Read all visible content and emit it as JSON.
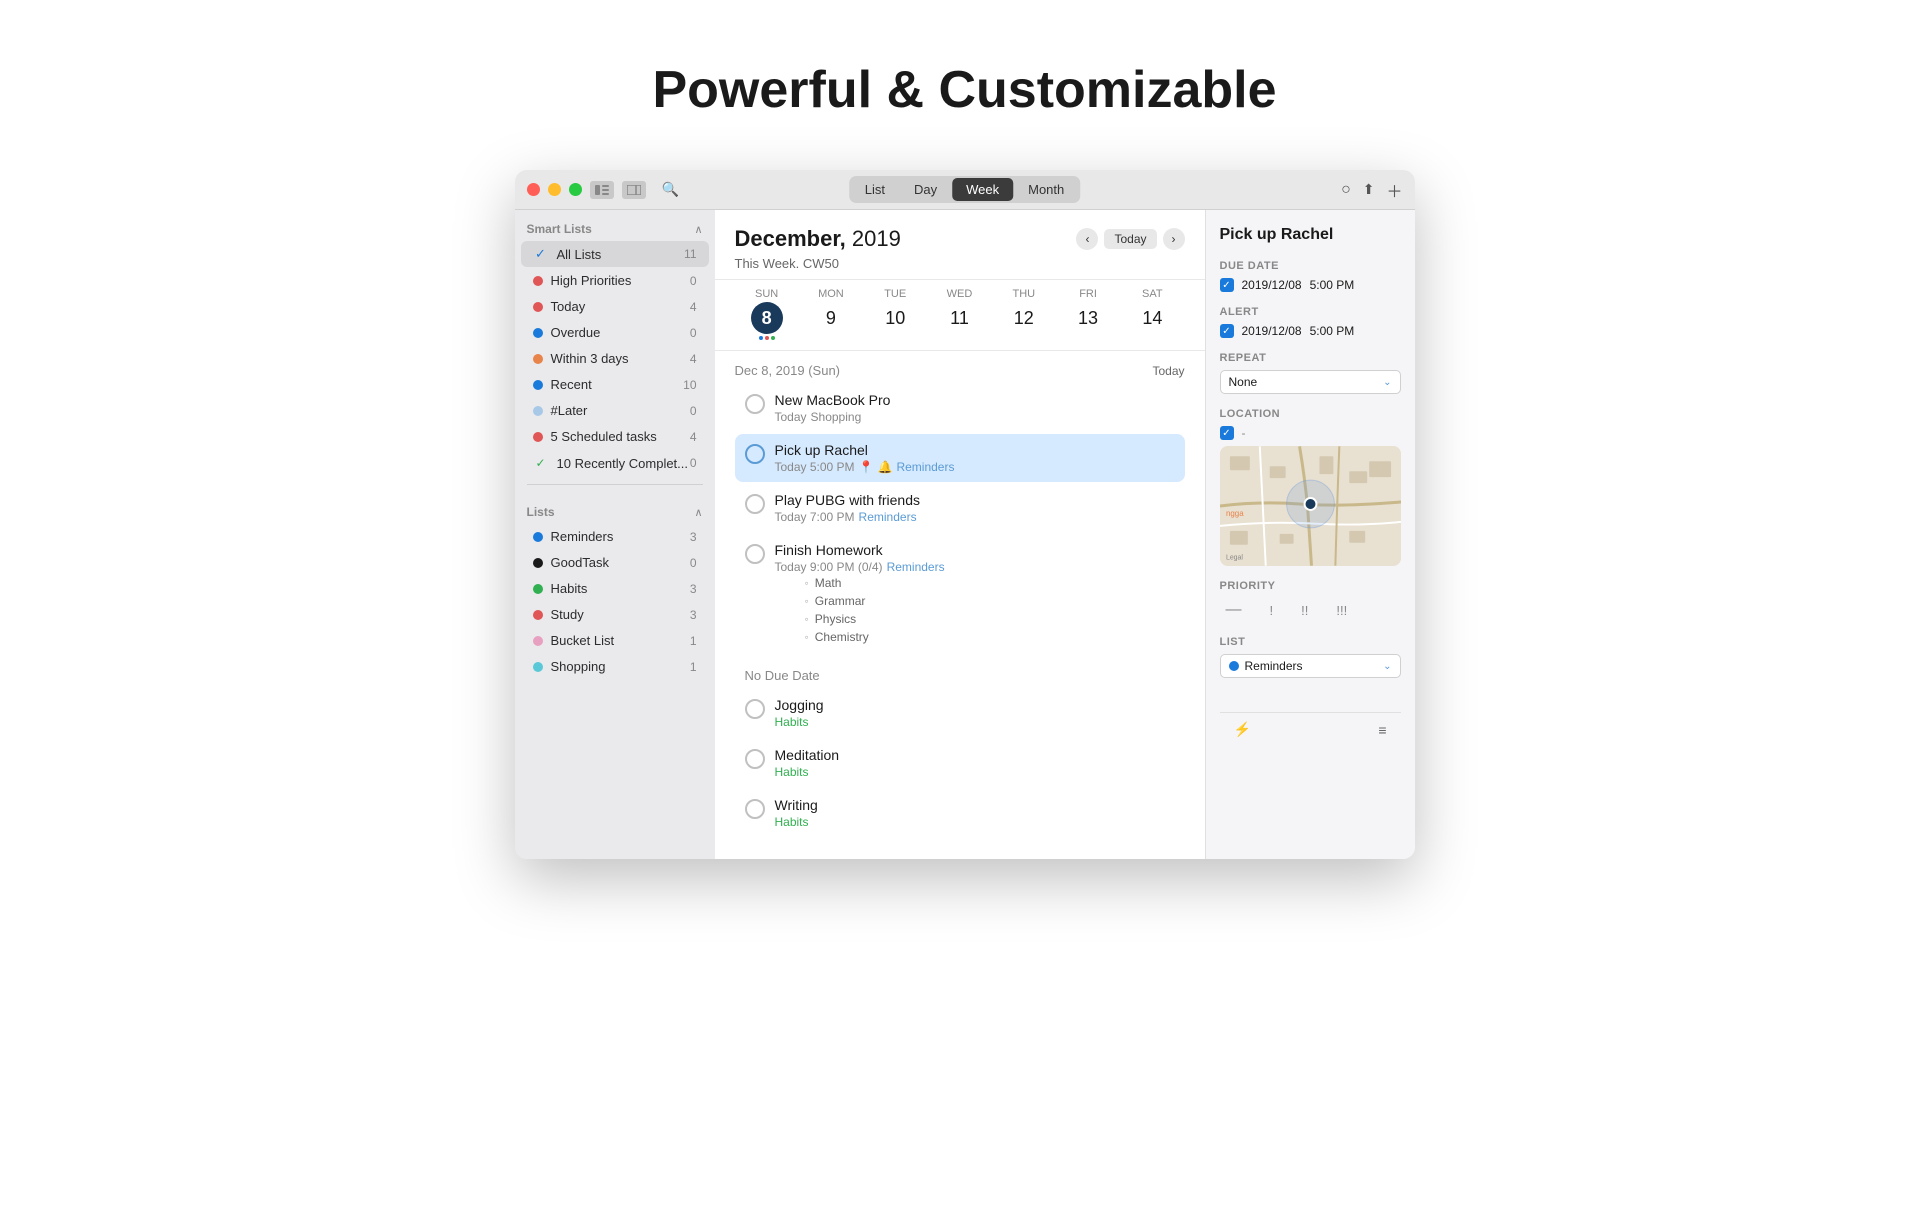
{
  "page": {
    "headline": "Powerful & Customizable"
  },
  "titlebar": {
    "segments": [
      "List",
      "Day",
      "Week",
      "Month"
    ],
    "active_segment": "Week",
    "right_icons": [
      "○",
      "⬆",
      "+"
    ]
  },
  "sidebar": {
    "smart_lists_label": "Smart Lists",
    "lists_label": "Lists",
    "smart_items": [
      {
        "id": "all-lists",
        "label": "All Lists",
        "count": "11",
        "color": "#1a7adb",
        "icon": "✓",
        "active": true
      },
      {
        "id": "high-priorities",
        "label": "High Priorities",
        "count": "0",
        "color": "#e05555",
        "dot": true
      },
      {
        "id": "today",
        "label": "Today",
        "count": "4",
        "color": "#e05555",
        "dot": true
      },
      {
        "id": "overdue",
        "label": "Overdue",
        "count": "0",
        "color": "#1a7adb",
        "dot": true
      },
      {
        "id": "within-3-days",
        "label": "Within 3 days",
        "count": "4",
        "color": "#e8834a",
        "dot": true
      },
      {
        "id": "recent",
        "label": "Recent",
        "count": "10",
        "color": "#1a7adb",
        "dot": true
      },
      {
        "id": "later",
        "label": "#Later",
        "count": "0",
        "color": "#a8c8e8",
        "dot": true
      },
      {
        "id": "scheduled",
        "label": "5 Scheduled tasks",
        "count": "4",
        "color": "#e05555",
        "dot": true
      },
      {
        "id": "recently-completed",
        "label": "10 Recently Complet...",
        "count": "0",
        "color": "#30b050",
        "icon": "✓",
        "dot": false
      }
    ],
    "list_items": [
      {
        "id": "reminders",
        "label": "Reminders",
        "count": "3",
        "color": "#1a7adb",
        "dot": true
      },
      {
        "id": "goodtask",
        "label": "GoodTask",
        "count": "0",
        "color": "#1a1a1a",
        "dot": true
      },
      {
        "id": "habits",
        "label": "Habits",
        "count": "3",
        "color": "#30b050",
        "dot": true
      },
      {
        "id": "study",
        "label": "Study",
        "count": "3",
        "color": "#e05555",
        "dot": true
      },
      {
        "id": "bucket-list",
        "label": "Bucket List",
        "count": "1",
        "color": "#e8a0c0",
        "dot": true
      },
      {
        "id": "shopping",
        "label": "Shopping",
        "count": "1",
        "color": "#5bc8d8",
        "dot": true
      }
    ]
  },
  "calendar": {
    "title_bold": "December,",
    "title_year": " 2019",
    "subtitle": "This Week. CW50",
    "today_btn": "Today",
    "date_label": "Dec 8, 2019 (Sun)",
    "today_label": "Today",
    "week_days": [
      {
        "name": "Sun",
        "num": "8",
        "today": true
      },
      {
        "name": "Mon",
        "num": "9",
        "today": false
      },
      {
        "name": "Tue",
        "num": "10",
        "today": false
      },
      {
        "name": "Wed",
        "num": "11",
        "today": false
      },
      {
        "name": "Thu",
        "num": "12",
        "today": false
      },
      {
        "name": "Fri",
        "num": "13",
        "today": false
      },
      {
        "name": "Sat",
        "num": "14",
        "today": false
      }
    ]
  },
  "tasks": {
    "today_section": "Dec 8, 2019 (Sun)",
    "today_label": "Today",
    "items": [
      {
        "id": "new-macbook",
        "title": "New MacBook Pro",
        "meta": "Today  Shopping",
        "meta_tag": "Shopping",
        "selected": false
      },
      {
        "id": "pick-up-rachel",
        "title": "Pick up Rachel",
        "meta": "Today 5:00 PM  📍  🔔  Reminders",
        "meta_tag": "Reminders",
        "selected": true
      },
      {
        "id": "play-pubg",
        "title": "Play PUBG with friends",
        "meta": "Today 7:00 PM  Reminders",
        "meta_tag": "Reminders",
        "selected": false
      },
      {
        "id": "finish-homework",
        "title": "Finish Homework",
        "meta": "Today 9:00 PM (0/4)  Reminders",
        "meta_tag": "Reminders",
        "selected": false,
        "subtasks": [
          "Math",
          "Grammar",
          "Physics",
          "Chemistry"
        ]
      }
    ],
    "no_due_date_label": "No Due Date",
    "no_due_items": [
      {
        "id": "jogging",
        "title": "Jogging",
        "tag": "Habits",
        "tag_color": "habits"
      },
      {
        "id": "meditation",
        "title": "Meditation",
        "tag": "Habits",
        "tag_color": "habits"
      },
      {
        "id": "writing",
        "title": "Writing",
        "tag": "Habits",
        "tag_color": "habits"
      }
    ]
  },
  "detail": {
    "title": "Pick up Rachel",
    "due_date_label": "Due Date",
    "due_date_value": "2019/12/08",
    "due_date_time": "5:00 PM",
    "alert_label": "Alert",
    "alert_value": "2019/12/08",
    "alert_time": "5:00 PM",
    "repeat_label": "Repeat",
    "repeat_value": "None",
    "location_label": "Location",
    "location_value": "-",
    "map_legal": "Legal",
    "priority_label": "Priority",
    "priority_options": [
      "-",
      "!",
      "!!",
      "!!!"
    ],
    "list_label": "List",
    "list_value": "Reminders"
  }
}
